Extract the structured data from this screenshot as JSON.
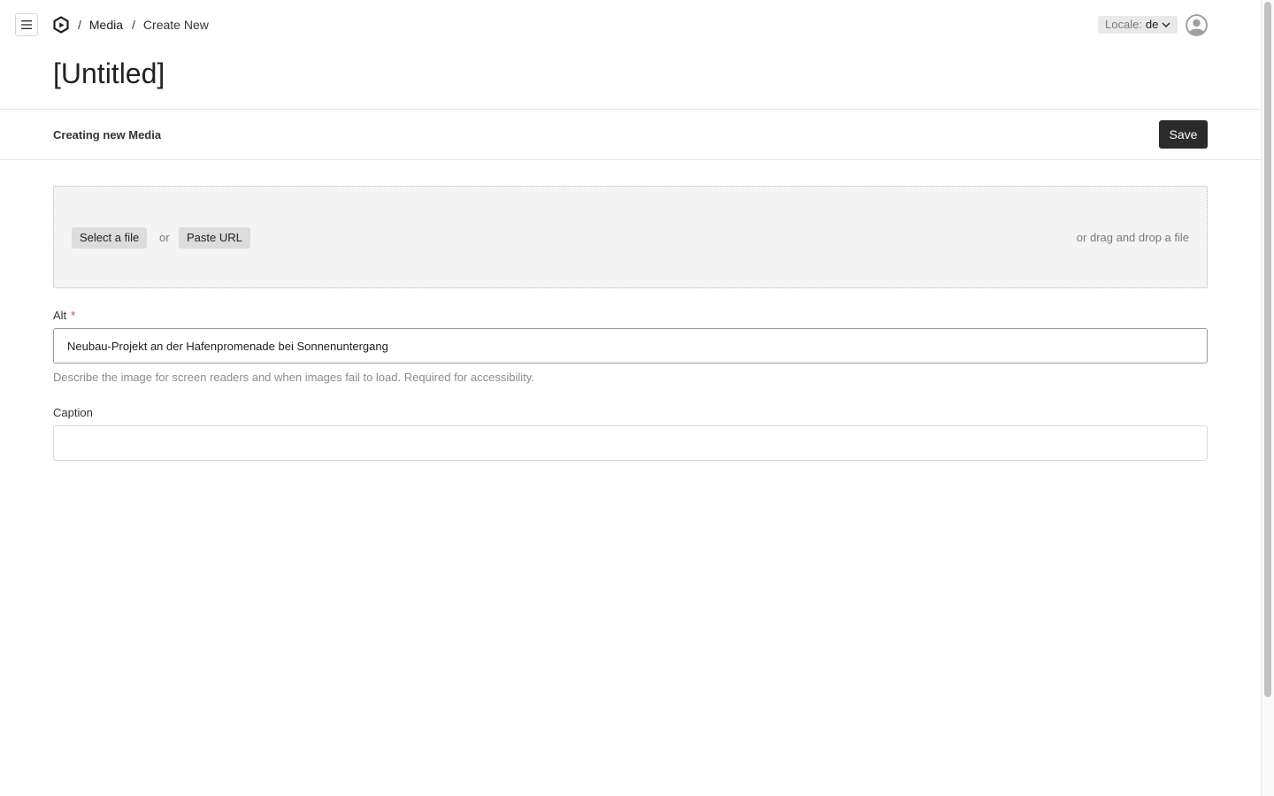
{
  "breadcrumb": {
    "separator": "/",
    "collection": "Media",
    "current": "Create New"
  },
  "locale": {
    "prefix": "Locale:",
    "value": "de"
  },
  "document": {
    "title": "[Untitled]",
    "status": "Creating new Media",
    "save_label": "Save"
  },
  "upload": {
    "select_label": "Select a file",
    "or_label": "or",
    "paste_label": "Paste URL",
    "drag_label": "or drag and drop a file"
  },
  "fields": {
    "alt": {
      "label": "Alt",
      "required_marker": "*",
      "value": "Neubau-Projekt an der Hafenpromenade bei Sonnenuntergang",
      "description": "Describe the image for screen readers and when images fail to load. Required for accessibility."
    },
    "caption": {
      "label": "Caption",
      "value": ""
    }
  },
  "icons": {
    "menu": "hamburger-menu-icon",
    "logo": "payload-logo-icon",
    "locale_chevron": "chevron-down-icon",
    "avatar": "default-user-avatar-icon"
  },
  "colors": {
    "primary_button": "#2b2b2b",
    "required": "#e0463a",
    "dropzone_bg": "#f4f4f4"
  }
}
